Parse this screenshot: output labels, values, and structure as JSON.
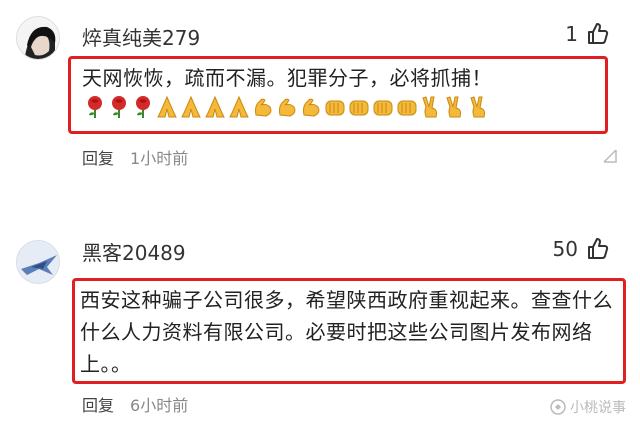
{
  "comments": [
    {
      "username": "焠真纯美279",
      "likes": "1",
      "text_line1": "天网恢恢，疏而不漏。犯罪分子，必将抓捕！",
      "emojis": [
        "rose",
        "rose",
        "rose",
        "pray",
        "pray",
        "pray",
        "pray",
        "muscle",
        "muscle",
        "muscle",
        "fist",
        "fist",
        "fist",
        "fist",
        "victory",
        "victory",
        "victory"
      ],
      "reply_label": "回复",
      "time": "1小时前"
    },
    {
      "username": "黑客20489",
      "likes": "50",
      "text": "西安这种骗子公司很多，希望陕西政府重视起来。查查什么什么人力资料有限公司。必要时把这些公司图片发布网络上。。",
      "reply_label": "回复",
      "time": "6小时前"
    }
  ],
  "watermark": "小桃说事",
  "colors": {
    "highlight_border": "#e02020",
    "text": "#222222",
    "meta": "#888888"
  }
}
